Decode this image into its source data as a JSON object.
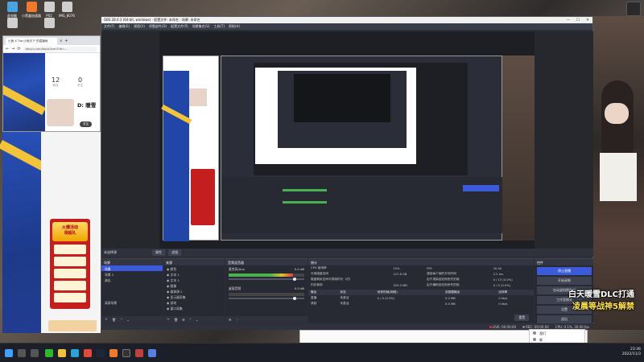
{
  "desktop": {
    "icons": [
      {
        "label": "此电脑",
        "color": "#4aa3df"
      },
      {
        "label": "小黑盒加速器",
        "color": "#ee7a2c"
      },
      {
        "label": "PS5",
        "color": "#cfcfcf"
      },
      {
        "label": "IMG_8076",
        "color": "#cfcfcf"
      },
      {
        "label": "",
        "color": "#cfcfcf"
      },
      {
        "label": "",
        "color": "#cfcfcf"
      }
    ]
  },
  "browser": {
    "tab_title": "小鱼 X Tian小鱼天下 的直播间",
    "url": "douyu.com/topic/xxm?rid=...",
    "stats": [
      {
        "value": "12",
        "label": "粉丝"
      },
      {
        "value": "0",
        "label": "关注"
      }
    ],
    "streamer_name": "D: 暖雪",
    "follow_label": "关注"
  },
  "promo": {
    "badge_line1": "火爆活动",
    "badge_line2": "领超礼"
  },
  "obs": {
    "title": "OBS 28.0.3 (64-bit, windows) - 配置文件: 未命名 - 场景: 未命名",
    "menu": [
      "文件(F)",
      "编辑(E)",
      "视图(V)",
      "停靠部件(D)",
      "配置文件(P)",
      "场景集合(S)",
      "工具(T)",
      "帮助(H)"
    ],
    "scene_bar": {
      "label": "未选择源",
      "properties": "属性",
      "filters": "滤镜"
    },
    "scenes": {
      "title": "场景",
      "items": [
        "场景",
        "场景 2",
        "演出",
        "",
        "",
        "",
        "录屏场景"
      ]
    },
    "sources": {
      "title": "来源",
      "items": [
        "颜色",
        "文本 1",
        "文本 2",
        "图像",
        "媒体源 2",
        "显示器采集",
        "游戏",
        "窗口采集"
      ]
    },
    "mixer": {
      "title": "音频混音器",
      "channels": [
        {
          "name": "麦克风/Aux",
          "db": "0.0 dB"
        },
        {
          "name": "桌面音频",
          "db": "0.0 dB"
        }
      ]
    },
    "stats": {
      "title": "统计",
      "rows": [
        {
          "k": "CPU 使用率",
          "v": "15%",
          "k2": "FPS",
          "v2": "30.00"
        },
        {
          "k": "可用磁盘空间",
          "v": "127.8 GB",
          "k2": "渲染每个帧的平均时间",
          "v2": "2.2 ms"
        },
        {
          "k": "磁盘剩余空间可录制时长（约）",
          "v": "",
          "k2": "由于渲染延迟而丢失的帧",
          "v2": "0 / 13 (0.0%)"
        },
        {
          "k": "内存使用",
          "v": "325.0 MB",
          "k2": "由于编码延迟而丢失的帧",
          "v2": "0 / 0 (0.0%)"
        }
      ],
      "output_headers": [
        "输出",
        "状态",
        "丢弃的帧(网络)",
        "总数据输出",
        "比特率"
      ],
      "outputs": [
        {
          "name": "直播",
          "status": "未激活",
          "dropped": "0 / 0 (0.0%)",
          "total": "0.0 MB",
          "bitrate": "0 kb/s"
        },
        {
          "name": "录制",
          "status": "未激活",
          "dropped": "",
          "total": "0.0 MB",
          "bitrate": "0 kb/s"
        }
      ],
      "reset": "重置"
    },
    "controls": {
      "title": "控件",
      "buttons": [
        "停止直播",
        "开始录制",
        "启动虚拟摄像机",
        "工作室模式",
        "设置",
        "退出"
      ]
    },
    "statusbar": {
      "live": "LIVE: 00:00:00",
      "rec": "REC: 00:00:00",
      "cpu": "CPU: 0.1%, 30.00 fps"
    }
  },
  "caption": {
    "line1": "白天暖雪DLC打通",
    "line2": "凌晨等战神5解禁"
  },
  "chat": {
    "btn_send": "关闭(C)",
    "btn_primary": "发送(S)"
  },
  "context_menu": {
    "items": [
      "我们",
      "聊",
      "待办事项的输入",
      "文件夹"
    ]
  },
  "taskbar": {
    "time": "23:36",
    "date": "2022/11/3"
  }
}
